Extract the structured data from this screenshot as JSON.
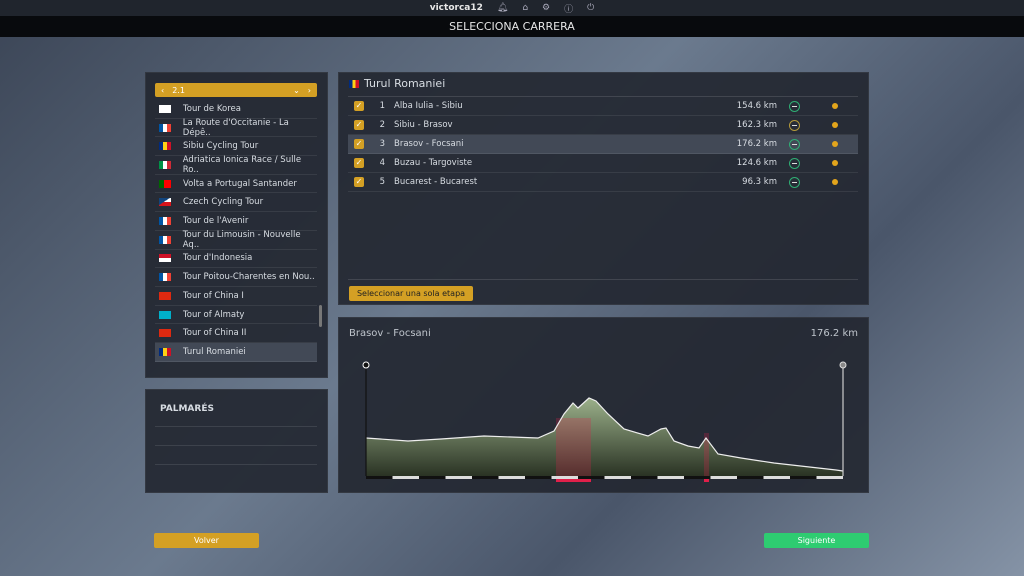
{
  "topbar": {
    "username": "victorca12",
    "icons": [
      "bell-icon",
      "home-icon",
      "gear-icon",
      "info-icon",
      "power-icon"
    ]
  },
  "title": "SELECCIONA CARRERA",
  "selector": {
    "value": "2.1"
  },
  "races": [
    {
      "name": "Tour de Korea",
      "flag": "kr"
    },
    {
      "name": "La Route d'Occitanie - La Dépê..",
      "flag": "fr"
    },
    {
      "name": "Sibiu Cycling Tour",
      "flag": "ro"
    },
    {
      "name": "Adriatica Ionica Race / Sulle Ro..",
      "flag": "it"
    },
    {
      "name": "Volta a Portugal Santander",
      "flag": "pt"
    },
    {
      "name": "Czech Cycling Tour",
      "flag": "cz"
    },
    {
      "name": "Tour de l'Avenir",
      "flag": "fr"
    },
    {
      "name": "Tour du Limousin - Nouvelle Aq..",
      "flag": "fr"
    },
    {
      "name": "Tour d'Indonesia",
      "flag": "id"
    },
    {
      "name": "Tour Poitou-Charentes en Nou..",
      "flag": "fr"
    },
    {
      "name": "Tour of China I",
      "flag": "cn"
    },
    {
      "name": "Tour of Almaty",
      "flag": "kz"
    },
    {
      "name": "Tour of China II",
      "flag": "cn"
    },
    {
      "name": "Turul Romaniei",
      "flag": "ro",
      "selected": true
    }
  ],
  "palmares": {
    "title": "PALMARÉS"
  },
  "race_detail": {
    "name": "Turul Romaniei",
    "flag": "ro",
    "stages": [
      {
        "num": "1",
        "name": "Alba Iulia - Sibiu",
        "km": "154.6 km",
        "terrain": "flat",
        "checked": true
      },
      {
        "num": "2",
        "name": "Sibiu - Brasov",
        "km": "162.3 km",
        "terrain": "hilly",
        "checked": true
      },
      {
        "num": "3",
        "name": "Brasov - Focsani",
        "km": "176.2 km",
        "terrain": "flat",
        "checked": true,
        "selected": true
      },
      {
        "num": "4",
        "name": "Buzau - Targoviste",
        "km": "124.6 km",
        "terrain": "flat",
        "checked": true
      },
      {
        "num": "5",
        "name": "Bucarest - Bucarest",
        "km": "96.3 km",
        "terrain": "flat",
        "checked": true
      }
    ],
    "single_stage_button": "Seleccionar una sola etapa"
  },
  "profile": {
    "stage": "Brasov - Focsani",
    "distance": "176.2 km"
  },
  "buttons": {
    "back": "Volver",
    "next": "Siguiente"
  },
  "colors": {
    "accent": "#d4a024",
    "next": "#2ecc71",
    "climb": "#e0204a"
  }
}
